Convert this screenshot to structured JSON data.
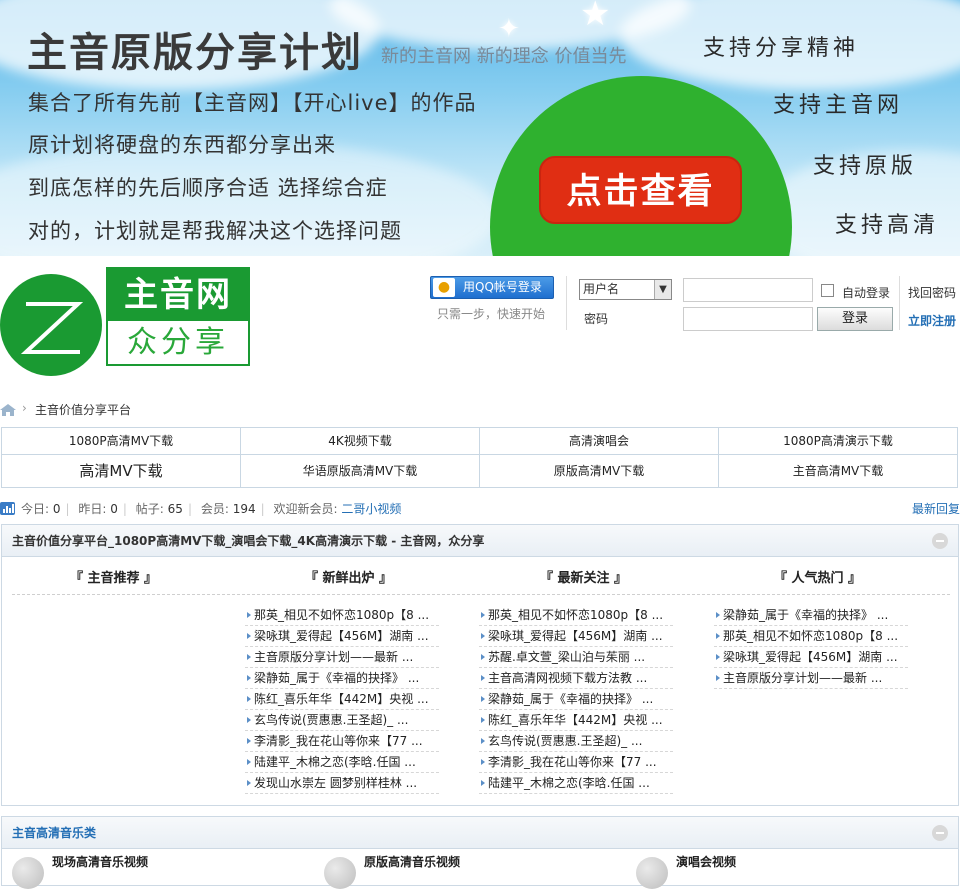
{
  "banner": {
    "title": "主音原版分享计划",
    "subtitle": "新的主音网 新的理念 价值当先",
    "lines": [
      "集合了所有先前【主音网】【开心live】的作品",
      "原计划将硬盘的东西都分享出来",
      "到底怎样的先后顺序合适 选择综合症",
      "对的，计划就是帮我解决这个选择问题"
    ],
    "right": [
      "支持分享精神",
      "支持主音网",
      "支持原版",
      "支持高清"
    ],
    "cta": "点击查看"
  },
  "logo": {
    "mark": "Z",
    "top": "主音网",
    "bottom": "众分享"
  },
  "login": {
    "qq_button": "用QQ帐号登录",
    "qq_hint": "只需一步，快速开始",
    "username_select": "用户名",
    "password_label": "密码",
    "auto_login": "自动登录",
    "login_button": "登录",
    "find_password": "找回密码",
    "register": "立即注册"
  },
  "breadcrumb": {
    "current": "主音价值分享平台"
  },
  "nav": {
    "row1": [
      "1080P高清MV下载",
      "4K视频下载",
      "高清演唱会",
      "1080P高清演示下载"
    ],
    "row2": [
      "高清MV下载",
      "华语原版高清MV下载",
      "原版高清MV下载",
      "主音高清MV下载"
    ]
  },
  "stats": {
    "today_label": "今日:",
    "today": "0",
    "yesterday_label": "昨日:",
    "yesterday": "0",
    "posts_label": "帖子:",
    "posts": "65",
    "members_label": "会员:",
    "members": "194",
    "welcome_label": "欢迎新会员:",
    "new_member": "二哥小视频",
    "latest_reply": "最新回复"
  },
  "panel1": {
    "title": "主音价值分享平台_1080P高清MV下载_演唱会下载_4K高清演示下载 - 主音网，众分享",
    "columns": [
      {
        "title": "『 主音推荐 』",
        "items": []
      },
      {
        "title": "『 新鲜出炉 』",
        "items": [
          "那英_相见不如怀恋1080p【8 ...",
          "梁咏琪_爱得起【456M】湖南 ...",
          "主音原版分享计划——最新 ...",
          "梁静茹_属于《幸福的抉择》 ...",
          "陈红_喜乐年华【442M】央视 ...",
          "玄鸟传说(贾惠惠.王圣超)_ ...",
          "李清影_我在花山等你来【77 ...",
          "陆建平_木棉之恋(李晗.任国 ...",
          "发现山水崇左 圆梦别样桂林 ..."
        ]
      },
      {
        "title": "『 最新关注 』",
        "items": [
          "那英_相见不如怀恋1080p【8 ...",
          "梁咏琪_爱得起【456M】湖南 ...",
          "苏醒.卓文萱_梁山泊与茱丽 ...",
          "主音高清网视频下载方法教 ...",
          "梁静茹_属于《幸福的抉择》 ...",
          "陈红_喜乐年华【442M】央视 ...",
          "玄鸟传说(贾惠惠.王圣超)_ ...",
          "李清影_我在花山等你来【77 ...",
          "陆建平_木棉之恋(李晗.任国 ..."
        ]
      },
      {
        "title": "『 人气热门 』",
        "items": [
          "梁静茹_属于《幸福的抉择》 ...",
          "那英_相见不如怀恋1080p【8 ...",
          "梁咏琪_爱得起【456M】湖南 ...",
          "主音原版分享计划——最新 ..."
        ]
      }
    ]
  },
  "panel2": {
    "title": "主音高清音乐类",
    "categories": [
      "现场高清音乐视频",
      "原版高清音乐视频",
      "演唱会视频"
    ]
  }
}
